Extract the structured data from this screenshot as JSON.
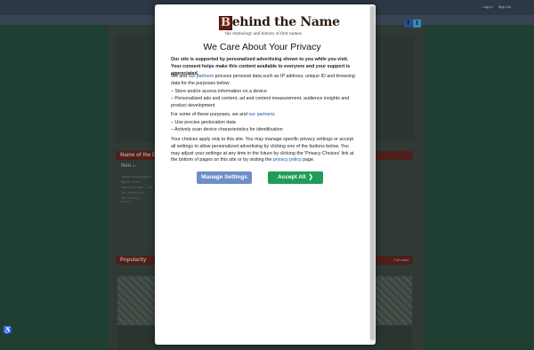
{
  "background": {
    "account_links": [
      "Log In",
      "Sign Up"
    ],
    "social": {
      "facebook_glyph": "f",
      "twitter_glyph": "t"
    },
    "section1_title": "Name of the D",
    "name_word": "Nen",
    "name_gender": "m",
    "snippet": "Norse mythological figure of the ... legend. It was ... the 1st century AD ... 1st century, ...",
    "more_link": "more...",
    "section2_title": "Popularity",
    "section2_tag": "Full chart",
    "accessibility_glyph": "♿"
  },
  "modal": {
    "logo_cap": "B",
    "logo_rest": "ehind the Name",
    "logo_sub": "the etymology and history of first names",
    "heading": "We Care About Your Privacy",
    "intro_bold": "Our site is supported by personalized advertising shown to you while you visit. Your consent helps make this content available to everyone and your support is appreciated.",
    "p1_pre": "We and ",
    "p1_link": "our partners",
    "p1_post": " process personal data such as IP address, unique ID and browsing data for the purposes below:",
    "list1": [
      "– Store and/or access information on a device",
      "– Personalised ads and content, ad and content measurement, audience insights and product development"
    ],
    "p2_pre": "For some of these purposes, we and ",
    "p2_link": "our partners",
    "p2_post": ":",
    "list2": [
      "– Use precise geolocation data",
      "– Actively scan device characteristics for identification"
    ],
    "p3_pre": "Your choices apply only to this site. You may manage specific privacy settings or accept all settings to allow personalized advertising by clicking one of the buttons below. You may adjust your settings at any time in the future by clicking the 'Privacy Choices' link at the bottom of pages on this site or by visiting the ",
    "p3_link": "privacy policy",
    "p3_post": " page.",
    "manage_label": "Manage Settings",
    "accept_label": "Accept All",
    "accept_chevron": "❯"
  }
}
